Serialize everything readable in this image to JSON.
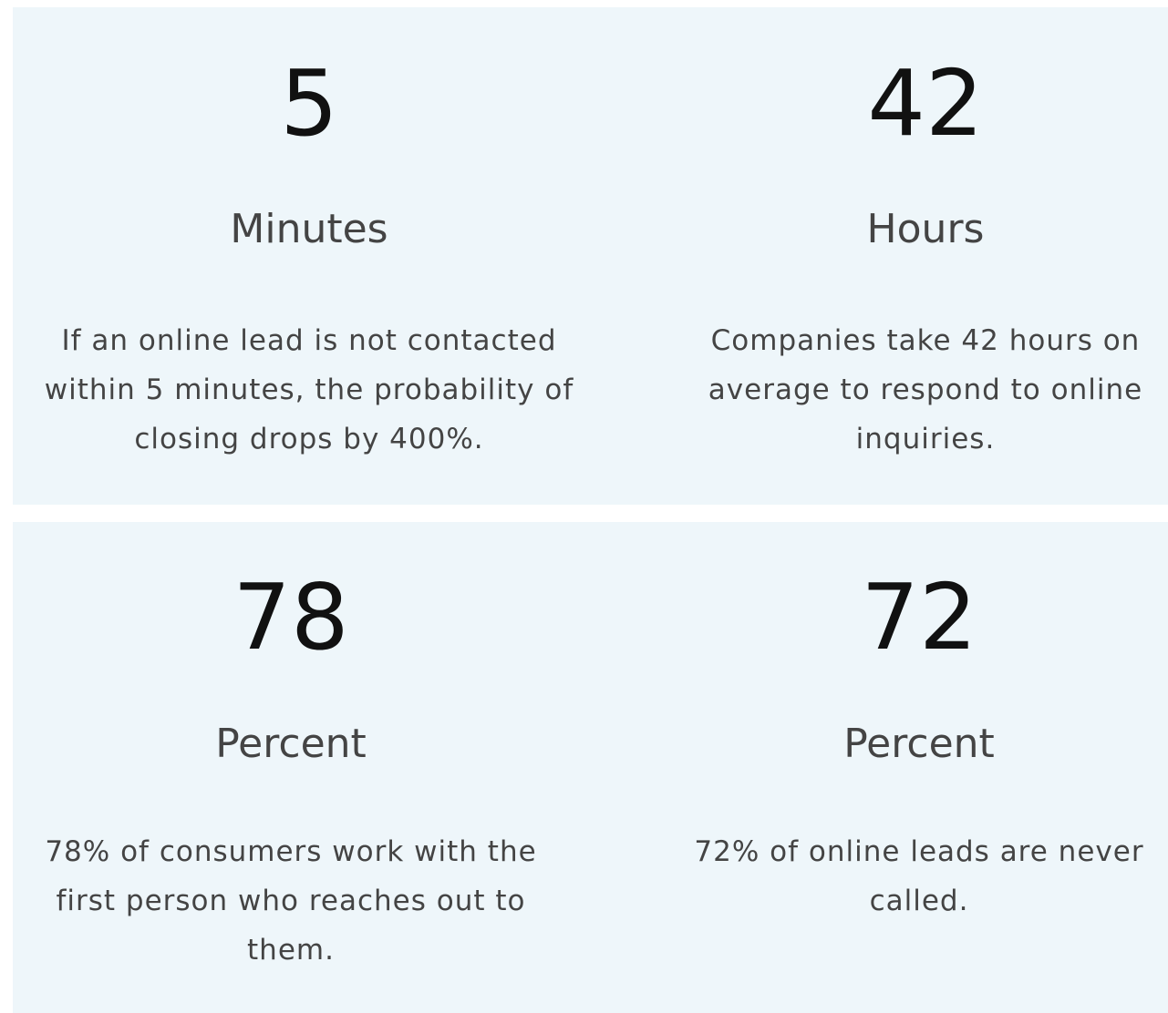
{
  "stats": [
    {
      "number": "5",
      "unit": "Minutes",
      "description": "If an online lead is not contacted within 5 minutes, the probability of closing drops by 400%."
    },
    {
      "number": "42",
      "unit": "Hours",
      "description": "Companies take 42 hours on average to respond to online inquiries."
    },
    {
      "number": "78",
      "unit": "Percent",
      "description": "78% of consumers work with the first person who reaches out to them."
    },
    {
      "number": "72",
      "unit": "Percent",
      "description": "72% of online leads are never called."
    }
  ],
  "colors": {
    "panel_background": "#eef6fa",
    "number_text": "#111111",
    "body_text": "#444444"
  }
}
